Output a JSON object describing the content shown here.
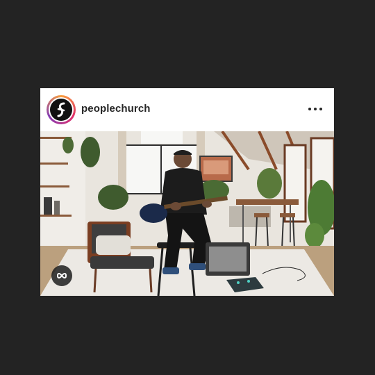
{
  "post": {
    "username": "peoplechurch",
    "avatar_icon": "people-church-logo-icon",
    "more_icon": "more-options-icon",
    "media_icon": "boomerang-icon"
  },
  "colors": {
    "background": "#232323",
    "card": "#ffffff",
    "username": "#262626"
  }
}
